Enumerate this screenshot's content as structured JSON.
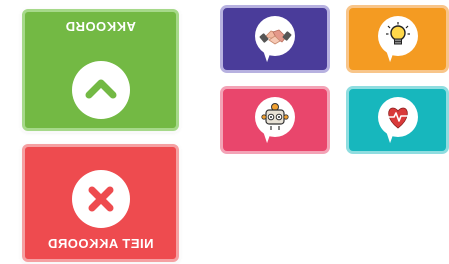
{
  "cards": {
    "agree": {
      "label": "AKKOORD",
      "color": "#73b944",
      "icon": "chevron-up-icon"
    },
    "disagree": {
      "label": "NIET AKKOORD",
      "color": "#ee4b4f",
      "icon": "close-x-icon"
    }
  },
  "tiles": [
    {
      "name": "tile-handshake",
      "color": "#4a3c9a",
      "icon": "handshake-icon"
    },
    {
      "name": "tile-idea",
      "color": "#f49b22",
      "icon": "lightbulb-icon"
    },
    {
      "name": "tile-robot",
      "color": "#e9466c",
      "icon": "robot-icon"
    },
    {
      "name": "tile-heart",
      "color": "#17b7bd",
      "icon": "heart-pulse-icon"
    }
  ]
}
